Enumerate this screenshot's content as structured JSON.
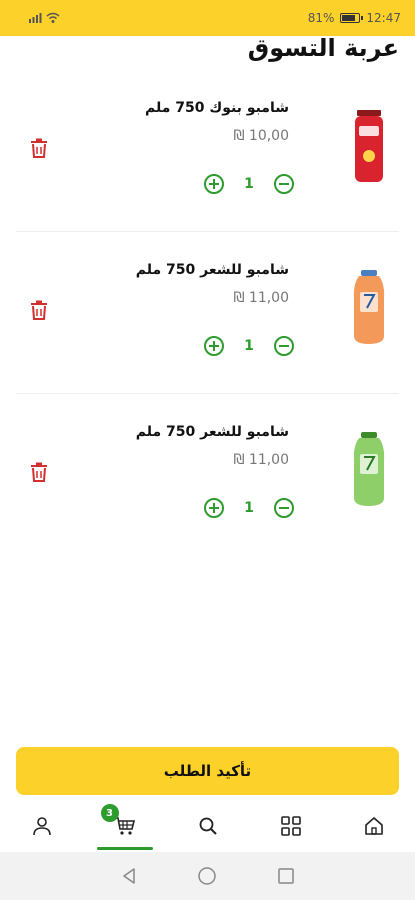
{
  "status_bar": {
    "left_icons": [
      "sim-icon",
      "wifi-icon"
    ],
    "battery": "81%",
    "battery_level": 0.81,
    "time": "12:47"
  },
  "page": {
    "title": "عربة التسوق"
  },
  "cart": {
    "items": [
      {
        "name": "شامبو بنوك  750 ملم",
        "price": "10,00 ₪",
        "quantity": "1",
        "image_color": "#d9232e"
      },
      {
        "name": "شامبو للشعر  750 ملم",
        "price": "11,00 ₪",
        "quantity": "1",
        "image_color": "#f39a5b"
      },
      {
        "name": "شامبو للشعر  750 ملم",
        "price": "11,00 ₪",
        "quantity": "1",
        "image_color": "#8fcf6a"
      }
    ]
  },
  "confirm_button": {
    "label": "تأكيد الطلب"
  },
  "bottom_nav": {
    "cart_badge": "3",
    "items": [
      "profile-icon",
      "cart-icon",
      "search-icon",
      "categories-icon",
      "home-icon"
    ],
    "active": "cart-icon"
  },
  "colors": {
    "brand_yellow": "#FCD12A",
    "accent_green": "#2e9b2e",
    "delete_red": "#d32f2f"
  },
  "system_nav": [
    "back-icon",
    "home-circle-icon",
    "recent-apps-icon"
  ]
}
